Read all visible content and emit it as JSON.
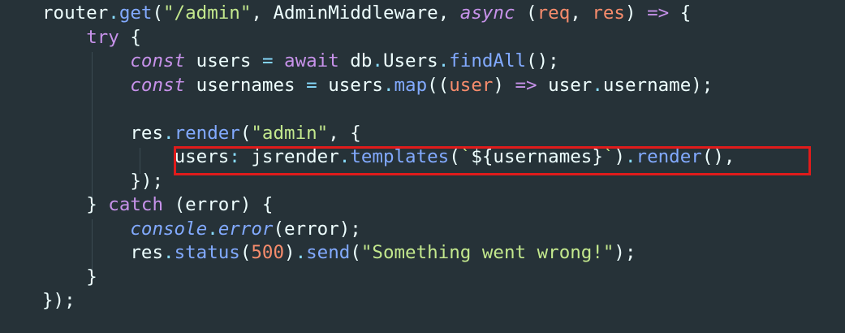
{
  "code": {
    "language": "javascript",
    "highlighted_line": 6,
    "colors": {
      "background": "#263238",
      "default": "#eeffff",
      "function": "#82aaff",
      "string": "#c3e88d",
      "keyword": "#c792ea",
      "parameter": "#f78c6c",
      "punctuation": "#89ddff",
      "highlight_border": "#e01b1b"
    },
    "lines": [
      [
        {
          "t": "router",
          "c": "def"
        },
        {
          "t": ".",
          "c": "punc"
        },
        {
          "t": "get",
          "c": "fn"
        },
        {
          "t": "(",
          "c": "def"
        },
        {
          "t": "\"/admin\"",
          "c": "str"
        },
        {
          "t": ", ",
          "c": "def"
        },
        {
          "t": "AdminMiddleware",
          "c": "def"
        },
        {
          "t": ", ",
          "c": "def"
        },
        {
          "t": "async",
          "c": "kwi"
        },
        {
          "t": " (",
          "c": "def"
        },
        {
          "t": "req",
          "c": "param"
        },
        {
          "t": ", ",
          "c": "def"
        },
        {
          "t": "res",
          "c": "param"
        },
        {
          "t": ") ",
          "c": "def"
        },
        {
          "t": "=>",
          "c": "kw"
        },
        {
          "t": " {",
          "c": "def"
        }
      ],
      [
        {
          "t": "    ",
          "c": "def"
        },
        {
          "t": "try",
          "c": "kw"
        },
        {
          "t": " {",
          "c": "def"
        }
      ],
      [
        {
          "t": "        ",
          "c": "def"
        },
        {
          "t": "const",
          "c": "kwi"
        },
        {
          "t": " users ",
          "c": "def"
        },
        {
          "t": "=",
          "c": "op"
        },
        {
          "t": " ",
          "c": "def"
        },
        {
          "t": "await",
          "c": "kw"
        },
        {
          "t": " db",
          "c": "def"
        },
        {
          "t": ".",
          "c": "punc"
        },
        {
          "t": "Users",
          "c": "def"
        },
        {
          "t": ".",
          "c": "punc"
        },
        {
          "t": "findAll",
          "c": "fn"
        },
        {
          "t": "();",
          "c": "def"
        }
      ],
      [
        {
          "t": "        ",
          "c": "def"
        },
        {
          "t": "const",
          "c": "kwi"
        },
        {
          "t": " usernames ",
          "c": "def"
        },
        {
          "t": "=",
          "c": "op"
        },
        {
          "t": " users",
          "c": "def"
        },
        {
          "t": ".",
          "c": "punc"
        },
        {
          "t": "map",
          "c": "fn"
        },
        {
          "t": "((",
          "c": "def"
        },
        {
          "t": "user",
          "c": "param"
        },
        {
          "t": ") ",
          "c": "def"
        },
        {
          "t": "=>",
          "c": "kw"
        },
        {
          "t": " user",
          "c": "def"
        },
        {
          "t": ".",
          "c": "punc"
        },
        {
          "t": "username",
          "c": "def"
        },
        {
          "t": ");",
          "c": "def"
        }
      ],
      [
        {
          "t": "",
          "c": "def"
        }
      ],
      [
        {
          "t": "        res",
          "c": "def"
        },
        {
          "t": ".",
          "c": "punc"
        },
        {
          "t": "render",
          "c": "fn"
        },
        {
          "t": "(",
          "c": "def"
        },
        {
          "t": "\"admin\"",
          "c": "str"
        },
        {
          "t": ", {",
          "c": "def"
        }
      ],
      [
        {
          "t": "            ",
          "c": "def"
        },
        {
          "t": "users",
          "c": "key"
        },
        {
          "t": ":",
          "c": "punc"
        },
        {
          "t": " jsrender",
          "c": "def"
        },
        {
          "t": ".",
          "c": "punc"
        },
        {
          "t": "templates",
          "c": "fn"
        },
        {
          "t": "(",
          "c": "def"
        },
        {
          "t": "`",
          "c": "str"
        },
        {
          "t": "${usernames}",
          "c": "def"
        },
        {
          "t": "`",
          "c": "str"
        },
        {
          "t": ")",
          "c": "def"
        },
        {
          "t": ".",
          "c": "punc"
        },
        {
          "t": "render",
          "c": "fn"
        },
        {
          "t": "(),",
          "c": "def"
        }
      ],
      [
        {
          "t": "        ",
          "c": "def"
        },
        {
          "t": "});",
          "c": "def"
        }
      ],
      [
        {
          "t": "    ",
          "c": "def"
        },
        {
          "t": "}",
          "c": "def"
        },
        {
          "t": " catch ",
          "c": "kw"
        },
        {
          "t": "(error) {",
          "c": "def"
        }
      ],
      [
        {
          "t": "        ",
          "c": "def"
        },
        {
          "t": "console",
          "c": "obj"
        },
        {
          "t": ".",
          "c": "punc"
        },
        {
          "t": "error",
          "c": "ital"
        },
        {
          "t": "(error);",
          "c": "def"
        }
      ],
      [
        {
          "t": "        res",
          "c": "def"
        },
        {
          "t": ".",
          "c": "punc"
        },
        {
          "t": "status",
          "c": "fn"
        },
        {
          "t": "(",
          "c": "def"
        },
        {
          "t": "500",
          "c": "num"
        },
        {
          "t": ")",
          "c": "def"
        },
        {
          "t": ".",
          "c": "punc"
        },
        {
          "t": "send",
          "c": "fn"
        },
        {
          "t": "(",
          "c": "def"
        },
        {
          "t": "\"Something went wrong!\"",
          "c": "str"
        },
        {
          "t": ");",
          "c": "def"
        }
      ],
      [
        {
          "t": "    ",
          "c": "def"
        },
        {
          "t": "}",
          "c": "def"
        }
      ],
      [
        {
          "t": "});",
          "c": "def"
        }
      ]
    ]
  }
}
